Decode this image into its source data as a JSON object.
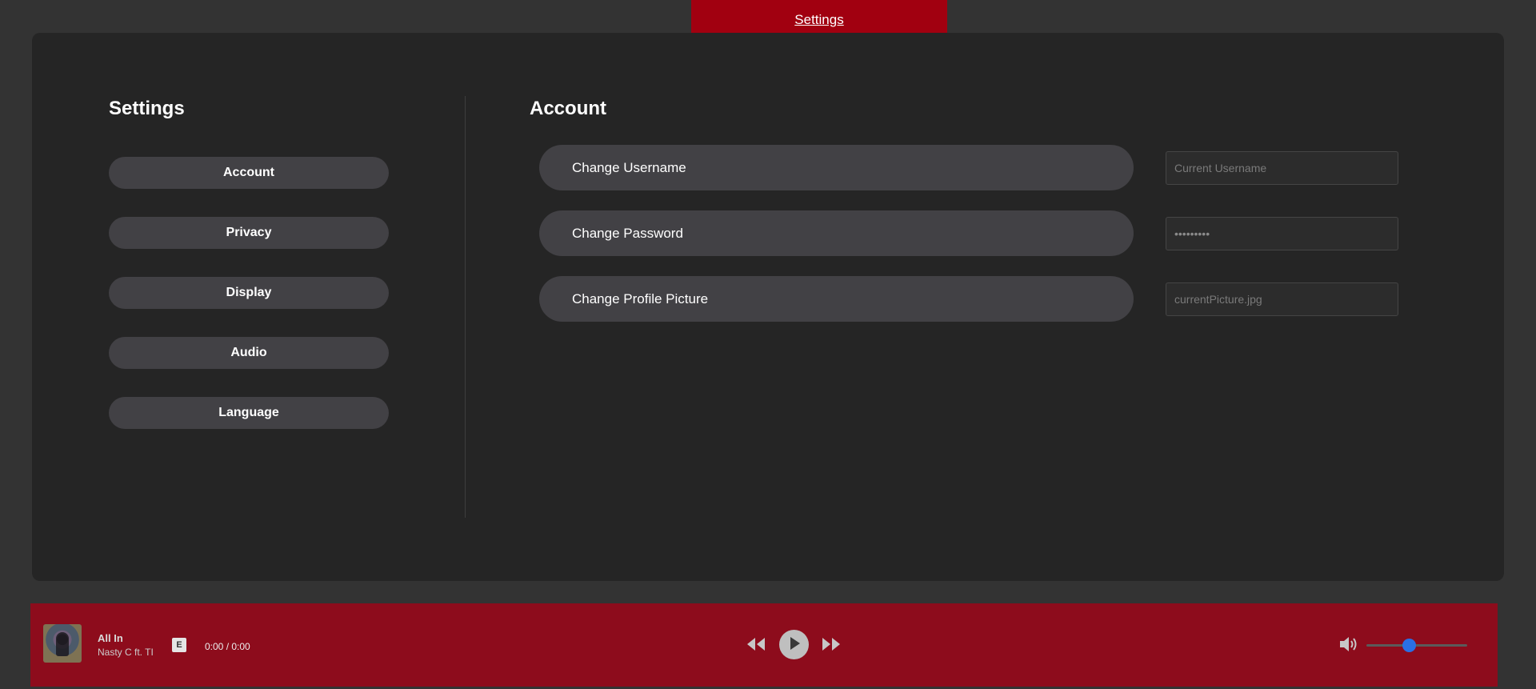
{
  "header": {
    "tab_label": "Settings"
  },
  "sidebar": {
    "title": "Settings",
    "items": [
      {
        "label": "Account"
      },
      {
        "label": "Privacy"
      },
      {
        "label": "Display"
      },
      {
        "label": "Audio"
      },
      {
        "label": "Language"
      }
    ]
  },
  "account": {
    "title": "Account",
    "rows": [
      {
        "button_label": "Change Username",
        "placeholder": "Current Username",
        "value": ""
      },
      {
        "button_label": "Change Password",
        "placeholder": "",
        "value": "•••••••••"
      },
      {
        "button_label": "Change Profile Picture",
        "placeholder": "currentPicture.jpg",
        "value": ""
      }
    ]
  },
  "player": {
    "track_title": "All In",
    "artist": "Nasty C ft. TI",
    "explicit_badge": "E",
    "time": "0:00 / 0:00",
    "volume_level": 0.42,
    "icons": [
      "rewind-icon",
      "play-icon",
      "fast-forward-icon",
      "volume-icon"
    ]
  },
  "colors": {
    "accent": "#a10010",
    "player_bg": "#8d0c1c",
    "slider_thumb": "#2a6fe4",
    "panel_bg": "#252525",
    "button_bg": "#424145"
  }
}
